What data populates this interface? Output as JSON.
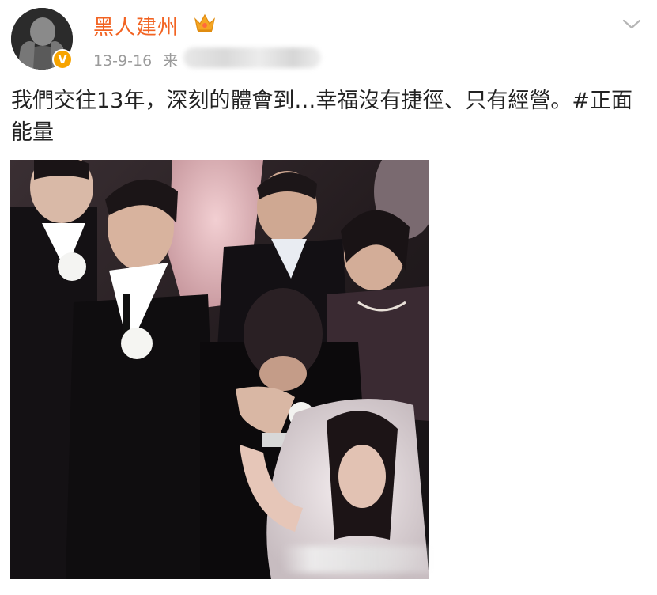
{
  "post": {
    "username": "黑人建州",
    "date": "13-9-16",
    "source_prefix": "来",
    "text": "我們交往13年，深刻的體會到…幸福沒有捷徑、只有經營。#正面能量"
  },
  "icons": {
    "verified": "verified-badge-icon",
    "crown": "crown-icon",
    "chevron": "chevron-down-icon"
  },
  "colors": {
    "username": "#f26322",
    "meta": "#9b9b9b",
    "verified": "#f7a400"
  }
}
